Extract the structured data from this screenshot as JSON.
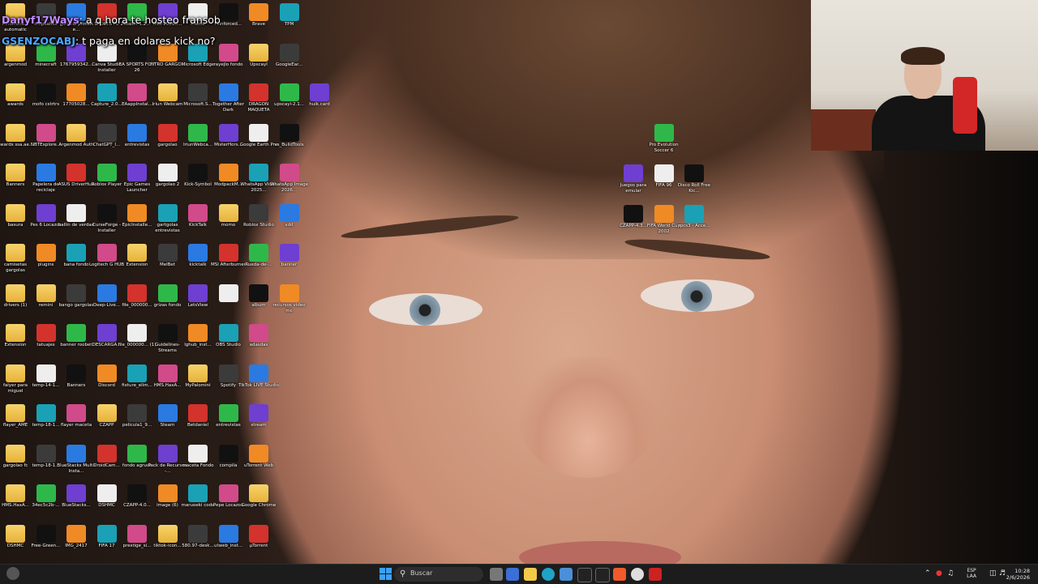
{
  "chat": [
    {
      "user": "Danyf17Ways",
      "message": ": a q hora te hosteo fransob"
    },
    {
      "user": "GSENZOCABJ",
      "message": ": t paga en dolares kick no?"
    }
  ],
  "desktop_icons": [
    [
      "Almacena... automatic",
      "mapashax",
      "gargola primer e...",
      "EA SPORTS FC 26",
      "fusion-1.2...",
      "IMG-20260...",
      "meme",
      "reinforced...",
      "Brave",
      "TPM",
      ""
    ],
    [
      "argenmod",
      "minecraft",
      "1767959342...",
      "Canva Studio Installer",
      "EA SPORTS FC™ 26",
      "INTRO GARGO...",
      "Microsoft Edge",
      "rayejlo fondo",
      "Upscayl",
      "GoogleEar...",
      ""
    ],
    [
      "awards",
      "mofo cstrtrs",
      "17705028...",
      "Capture_2.0...",
      "EAappInstal...",
      "Iriun Webcam",
      "Microsoft.S...",
      "Together After Dark",
      "DRAGON MAQUETA",
      "upscayl-2.1...",
      "huik.card"
    ],
    [
      "awards ssa.ae...",
      "NBTExplore...",
      "Argenmod Auth",
      "ChatGPT_I...",
      "entrevistas",
      "gargolao",
      "IriunWebca...",
      "MisterHors...",
      "Google Earth Pro",
      "vs_BuildTools",
      ""
    ],
    [
      "Banners",
      "Papelera de reciclaje",
      "ASUS DriverHub",
      "Roblox Player",
      "Epic Games Launcher",
      "gargolao 2",
      "Kick-Symbol",
      "ModpackM...",
      "WhatsApp Video 2025...",
      "WhatsApp Image 2026...",
      ""
    ],
    [
      "basura",
      "Pes 6 Locazos",
      "ballin de verdad",
      "CurseForge - Installer",
      "EpicInstalle...",
      "gartgolas entrevistas",
      "KickTalk",
      "momo",
      "Roblox Studio",
      "xdd",
      ""
    ],
    [
      "camisetas gargolas",
      "plugins",
      "bana fondo",
      "Logitech G HUB",
      "Extension",
      "MelBet",
      "kicktalk",
      "MSI Afterburner",
      "Rueda-de-...",
      "banner",
      ""
    ],
    [
      "drivers (1)",
      "remini",
      "bango gargolas",
      "Deep-Live...",
      "file_000000...",
      "grizas fondo",
      "LetsView",
      "",
      "album",
      "recursos video mc",
      ""
    ],
    [
      "Extension",
      "tatuajes",
      "banner roobet",
      "DESCARGA...",
      "file_000000... (1)",
      "Guidelines-Streams",
      "lghub_inst...",
      "OBS Studio",
      "adasdas",
      "",
      ""
    ],
    [
      "falyer para miguel",
      "temp-14-1...",
      "Banners",
      "Discord",
      "fixture_elim...",
      "HMS.HaxA...",
      "MyPalomini",
      "Spotify",
      "TikTok LIVE Studio",
      "",
      ""
    ],
    [
      "flayer_AME",
      "temp-18-1...",
      "flayer maceta",
      "CZAPP",
      "pelicula1_9...",
      "Steam",
      "Betdaniel",
      "entrevistas",
      "stream",
      "",
      ""
    ],
    [
      "gargolao fc",
      "temp-18-1...",
      "BlueStacks Multi-Insta...",
      "DroidCam...",
      "fondo agruck",
      "Pack de Recursos -...",
      "maceta Fondo",
      "compila",
      "uTorrent Web",
      "",
      ""
    ],
    [
      "HMS.HaxA...",
      "34ec5c2b-...",
      "BlueStacks...",
      "DSHMC",
      "CZAPP-4.0...",
      "image (6)",
      "maruoeki code",
      "Pepe Locazos",
      "Google Chrome",
      "",
      ""
    ],
    [
      "DSHMC",
      "Free-Green...",
      "IMG_2417",
      "FIFA 17",
      "prestige_si...",
      "tiktok-icon...",
      "580.97-desk...",
      "utweb_inst...",
      "µTorrent",
      "",
      ""
    ]
  ],
  "right_icons": [
    [
      "",
      "Pro Evolution Soccer 6",
      ""
    ],
    [
      "Juegos para emular",
      "FIFA 96",
      "Disco Roll Free Kic..."
    ],
    [
      "CZAPP-4.3...",
      "FIFA World Cup 2002",
      "rpcs3 - Acce..."
    ]
  ],
  "taskbar": {
    "search_placeholder": "Buscar",
    "lang_top": "ESP",
    "lang_bottom": "LAA",
    "time": "10:28",
    "date": "2/6/2026"
  }
}
